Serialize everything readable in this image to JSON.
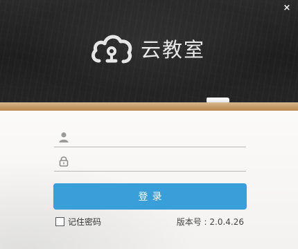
{
  "window": {
    "close_label": "×"
  },
  "header": {
    "brand_name": "云教室"
  },
  "form": {
    "username": {
      "value": "",
      "placeholder": ""
    },
    "password": {
      "value": "",
      "placeholder": ""
    },
    "login_label": "登录",
    "remember_label": "记住密码",
    "remember_checked": false,
    "version_text": "版本号 : 2.0.4.26"
  },
  "icons": [
    "close-icon",
    "cloud-logo-icon",
    "user-icon",
    "lock-icon"
  ],
  "colors": {
    "accent": "#3a9fd9",
    "board": "#222222",
    "ledge": "#c99f6c"
  }
}
